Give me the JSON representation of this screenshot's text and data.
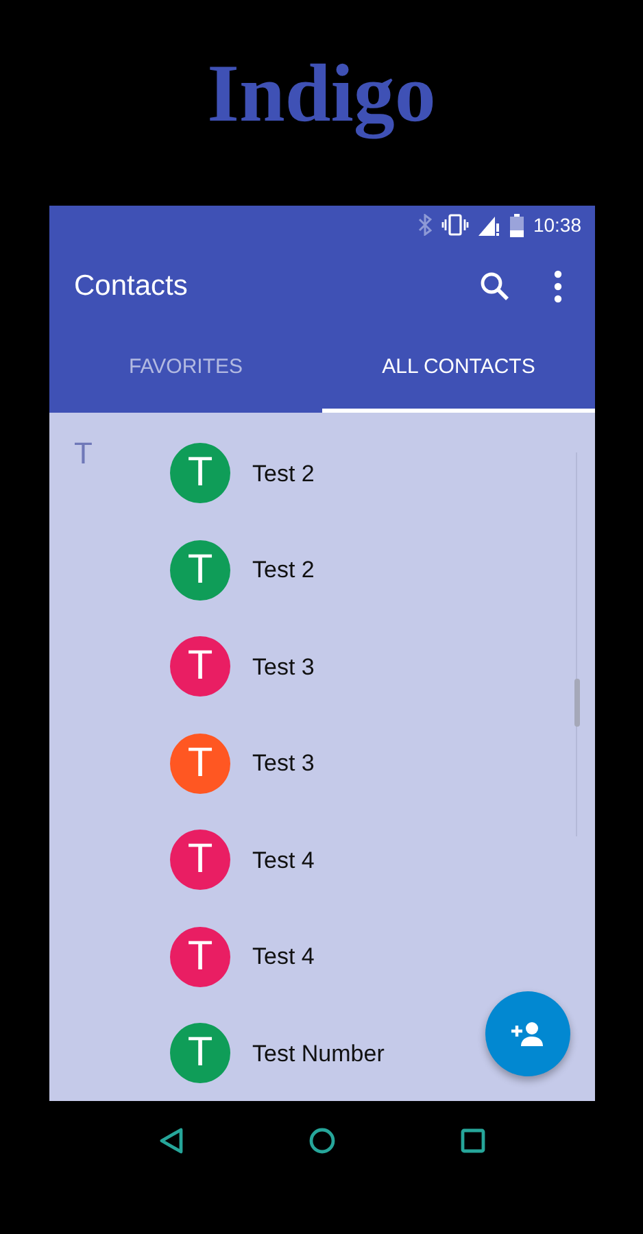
{
  "heading": "Indigo",
  "status_bar": {
    "time": "10:38"
  },
  "toolbar": {
    "title": "Contacts"
  },
  "tabs": [
    {
      "label": "FAVORITES",
      "selected": false
    },
    {
      "label": "ALL CONTACTS",
      "selected": true
    }
  ],
  "sections": [
    {
      "letter": "T",
      "contacts": [
        {
          "initial": "T",
          "name": "Test 2",
          "color": "#0f9d58"
        },
        {
          "initial": "T",
          "name": "Test 2",
          "color": "#0f9d58"
        },
        {
          "initial": "T",
          "name": "Test 3",
          "color": "#e91e63"
        },
        {
          "initial": "T",
          "name": "Test 3",
          "color": "#ff5722"
        },
        {
          "initial": "T",
          "name": "Test 4",
          "color": "#e91e63"
        },
        {
          "initial": "T",
          "name": "Test 4",
          "color": "#e91e63"
        },
        {
          "initial": "T",
          "name": "Test Number",
          "color": "#0f9d58"
        }
      ]
    }
  ]
}
